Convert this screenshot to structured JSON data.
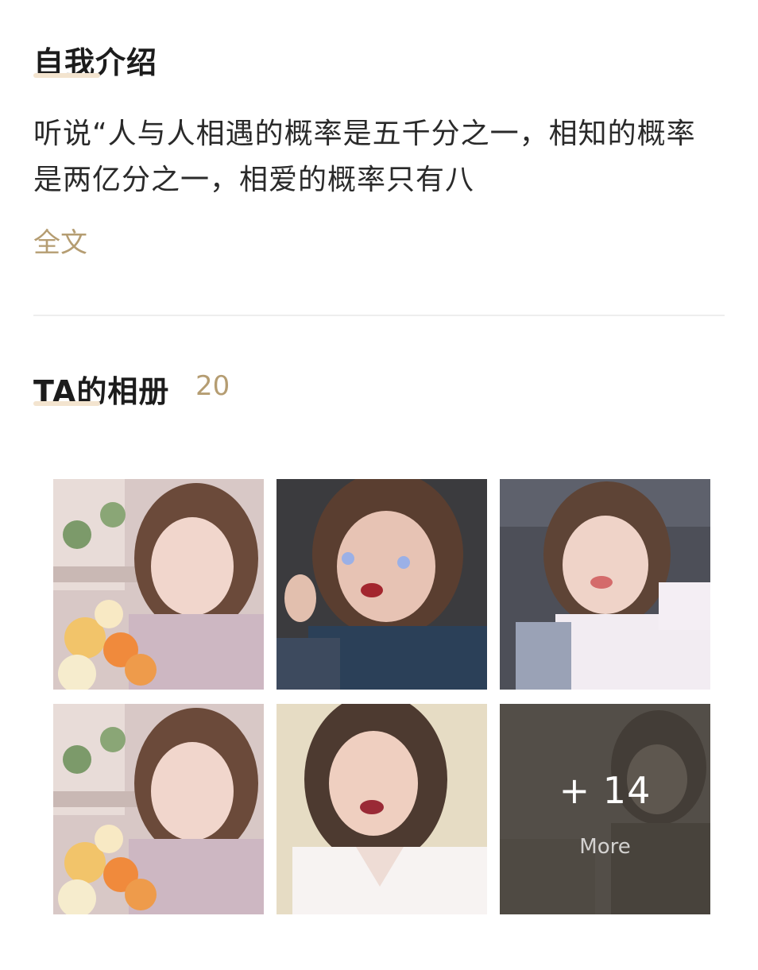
{
  "intro": {
    "title": "自我介绍",
    "text": "听说“人与人相遇的概率是五千分之一，相知的概率是两亿分之一，相爱的概率只有八",
    "read_more": "全文"
  },
  "album": {
    "title": "TA的相册",
    "count": "20",
    "more_count": "+ 14",
    "more_label": "More",
    "photos": [
      "photo-1",
      "photo-2",
      "photo-3",
      "photo-4",
      "photo-5",
      "photo-6"
    ]
  },
  "colors": {
    "accent": "#b59d72",
    "title_underline": "#f3e4cf",
    "divider": "#eeeeee"
  }
}
